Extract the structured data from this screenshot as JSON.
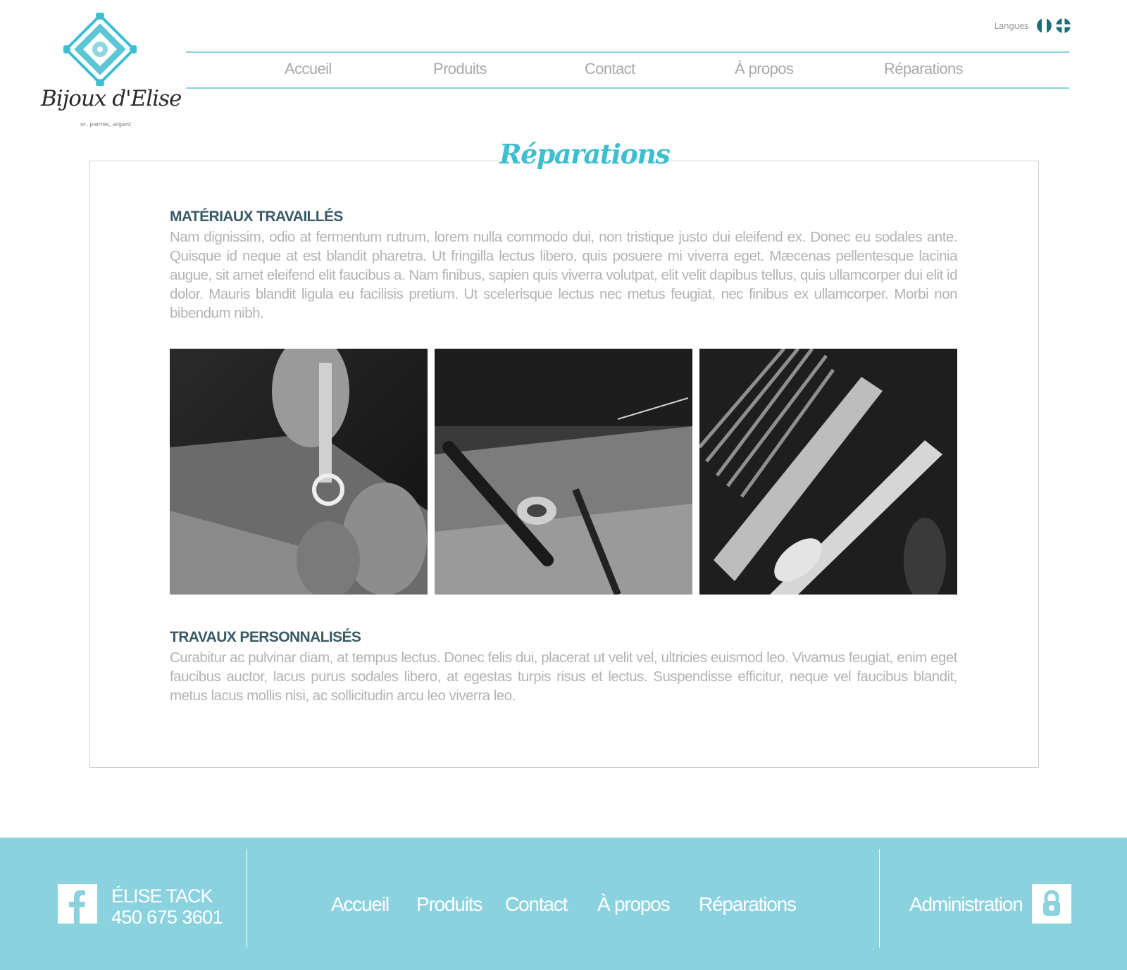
{
  "header": {
    "logo_name": "Bijoux d'Elise",
    "logo_tagline": "or, pierres, argent",
    "languages_label": "Langues"
  },
  "nav": {
    "items": [
      "Accueil",
      "Produits",
      "Contact",
      "À propos",
      "Réparations"
    ]
  },
  "page": {
    "title": "Réparations",
    "sections": [
      {
        "heading": "MATÉRIAUX TRAVAILLÉS",
        "text": "Nam dignissim, odio at fermentum rutrum, lorem nulla commodo dui, non tristique justo dui eleifend ex. Donec eu sodales ante. Quisque id neque at est blandit pharetra. Ut fringilla lectus libero, quis posuere mi viverra eget. Mæcenas pellentesque lacinia augue, sit amet eleifend elit faucibus a. Nam finibus, sapien quis viverra volutpat, elit velit dapibus tellus, quis ullamcorper dui elit id dolor. Mauris blandit ligula eu facilisis pretium. Ut scelerisque lectus nec metus feugiat, nec finibus ex ullamcorper. Morbi non bibendum nibh."
      },
      {
        "heading": "TRAVAUX PERSONNALISÉS",
        "text": "Curabitur ac pulvinar diam, at tempus lectus. Donec felis dui, placerat ut velit vel, ultricies euismod leo. Vivamus feugiat, enim eget faucibus auctor, lacus purus sodales libero, at egestas turpis risus et lectus. Suspendisse efficitur, neque vel faucibus blandit, metus lacus mollis nisi, ac sollicitudin arcu leo viverra leo."
      }
    ]
  },
  "footer": {
    "owner_name": "ÉLISE TACK",
    "owner_phone": "450 675 3601",
    "nav_items": [
      "Accueil",
      "Produits",
      "Contact",
      "À propos",
      "Réparations"
    ],
    "admin_label": "Administration"
  },
  "colors": {
    "accent": "#3ebfd0",
    "nav_border": "#8ad2de",
    "footer_bg": "#8bd2df",
    "heading": "#3a5a66",
    "body_text": "#b3b3b3"
  }
}
